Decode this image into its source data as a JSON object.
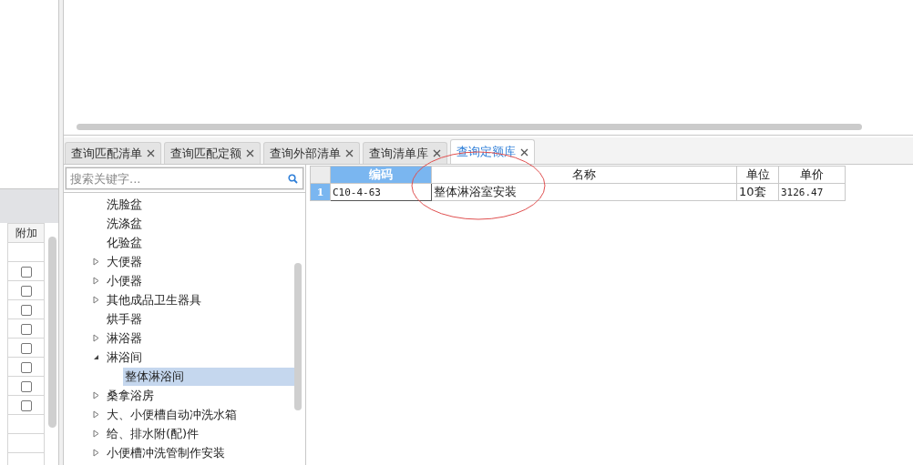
{
  "left_table": {
    "columns": [
      "附加"
    ],
    "rows": [
      {
        "kind": "empty"
      },
      {
        "kind": "check",
        "checked": false
      },
      {
        "kind": "check",
        "checked": false
      },
      {
        "kind": "check",
        "checked": false
      },
      {
        "kind": "check",
        "checked": false
      },
      {
        "kind": "check",
        "checked": false
      },
      {
        "kind": "check",
        "checked": false
      },
      {
        "kind": "check",
        "checked": false
      },
      {
        "kind": "check",
        "checked": false
      },
      {
        "kind": "empty"
      },
      {
        "kind": "empty"
      },
      {
        "kind": "empty"
      }
    ]
  },
  "tabs": [
    {
      "label": "查询匹配清单",
      "selected": false
    },
    {
      "label": "查询匹配定额",
      "selected": false
    },
    {
      "label": "查询外部清单",
      "selected": false
    },
    {
      "label": "查询清单库",
      "selected": false
    },
    {
      "label": "查询定额库",
      "selected": true
    }
  ],
  "search": {
    "placeholder": "搜索关键字..."
  },
  "tree": [
    {
      "label": "洗脸盆",
      "kind": "leaf",
      "selected": false
    },
    {
      "label": "洗涤盆",
      "kind": "leaf",
      "selected": false
    },
    {
      "label": "化验盆",
      "kind": "leaf",
      "selected": false
    },
    {
      "label": "大便器",
      "kind": "group",
      "expanded": false,
      "selected": false
    },
    {
      "label": "小便器",
      "kind": "group",
      "expanded": false,
      "selected": false
    },
    {
      "label": "其他成品卫生器具",
      "kind": "group",
      "expanded": false,
      "selected": false
    },
    {
      "label": "烘手器",
      "kind": "leaf",
      "selected": false
    },
    {
      "label": "淋浴器",
      "kind": "group",
      "expanded": false,
      "selected": false
    },
    {
      "label": "淋浴间",
      "kind": "group",
      "expanded": true,
      "selected": false,
      "children": [
        {
          "label": "整体淋浴间",
          "kind": "leaf",
          "selected": true
        }
      ]
    },
    {
      "label": "桑拿浴房",
      "kind": "group",
      "expanded": false,
      "selected": false
    },
    {
      "label": "大、小便槽自动冲洗水箱",
      "kind": "group",
      "expanded": false,
      "selected": false
    },
    {
      "label": "给、排水附(配)件",
      "kind": "group",
      "expanded": false,
      "selected": false
    },
    {
      "label": "小便槽冲洗管制作安装",
      "kind": "group",
      "expanded": false,
      "selected": false
    }
  ],
  "grid": {
    "columns": [
      {
        "label": "编码",
        "selected": true
      },
      {
        "label": "名称",
        "selected": false
      },
      {
        "label": "单位",
        "selected": false
      },
      {
        "label": "单价",
        "selected": false
      }
    ],
    "rows": [
      {
        "number": "1",
        "cells": [
          "C10-4-63",
          "整体淋浴室安装",
          "10套",
          "3126.47"
        ]
      }
    ]
  }
}
